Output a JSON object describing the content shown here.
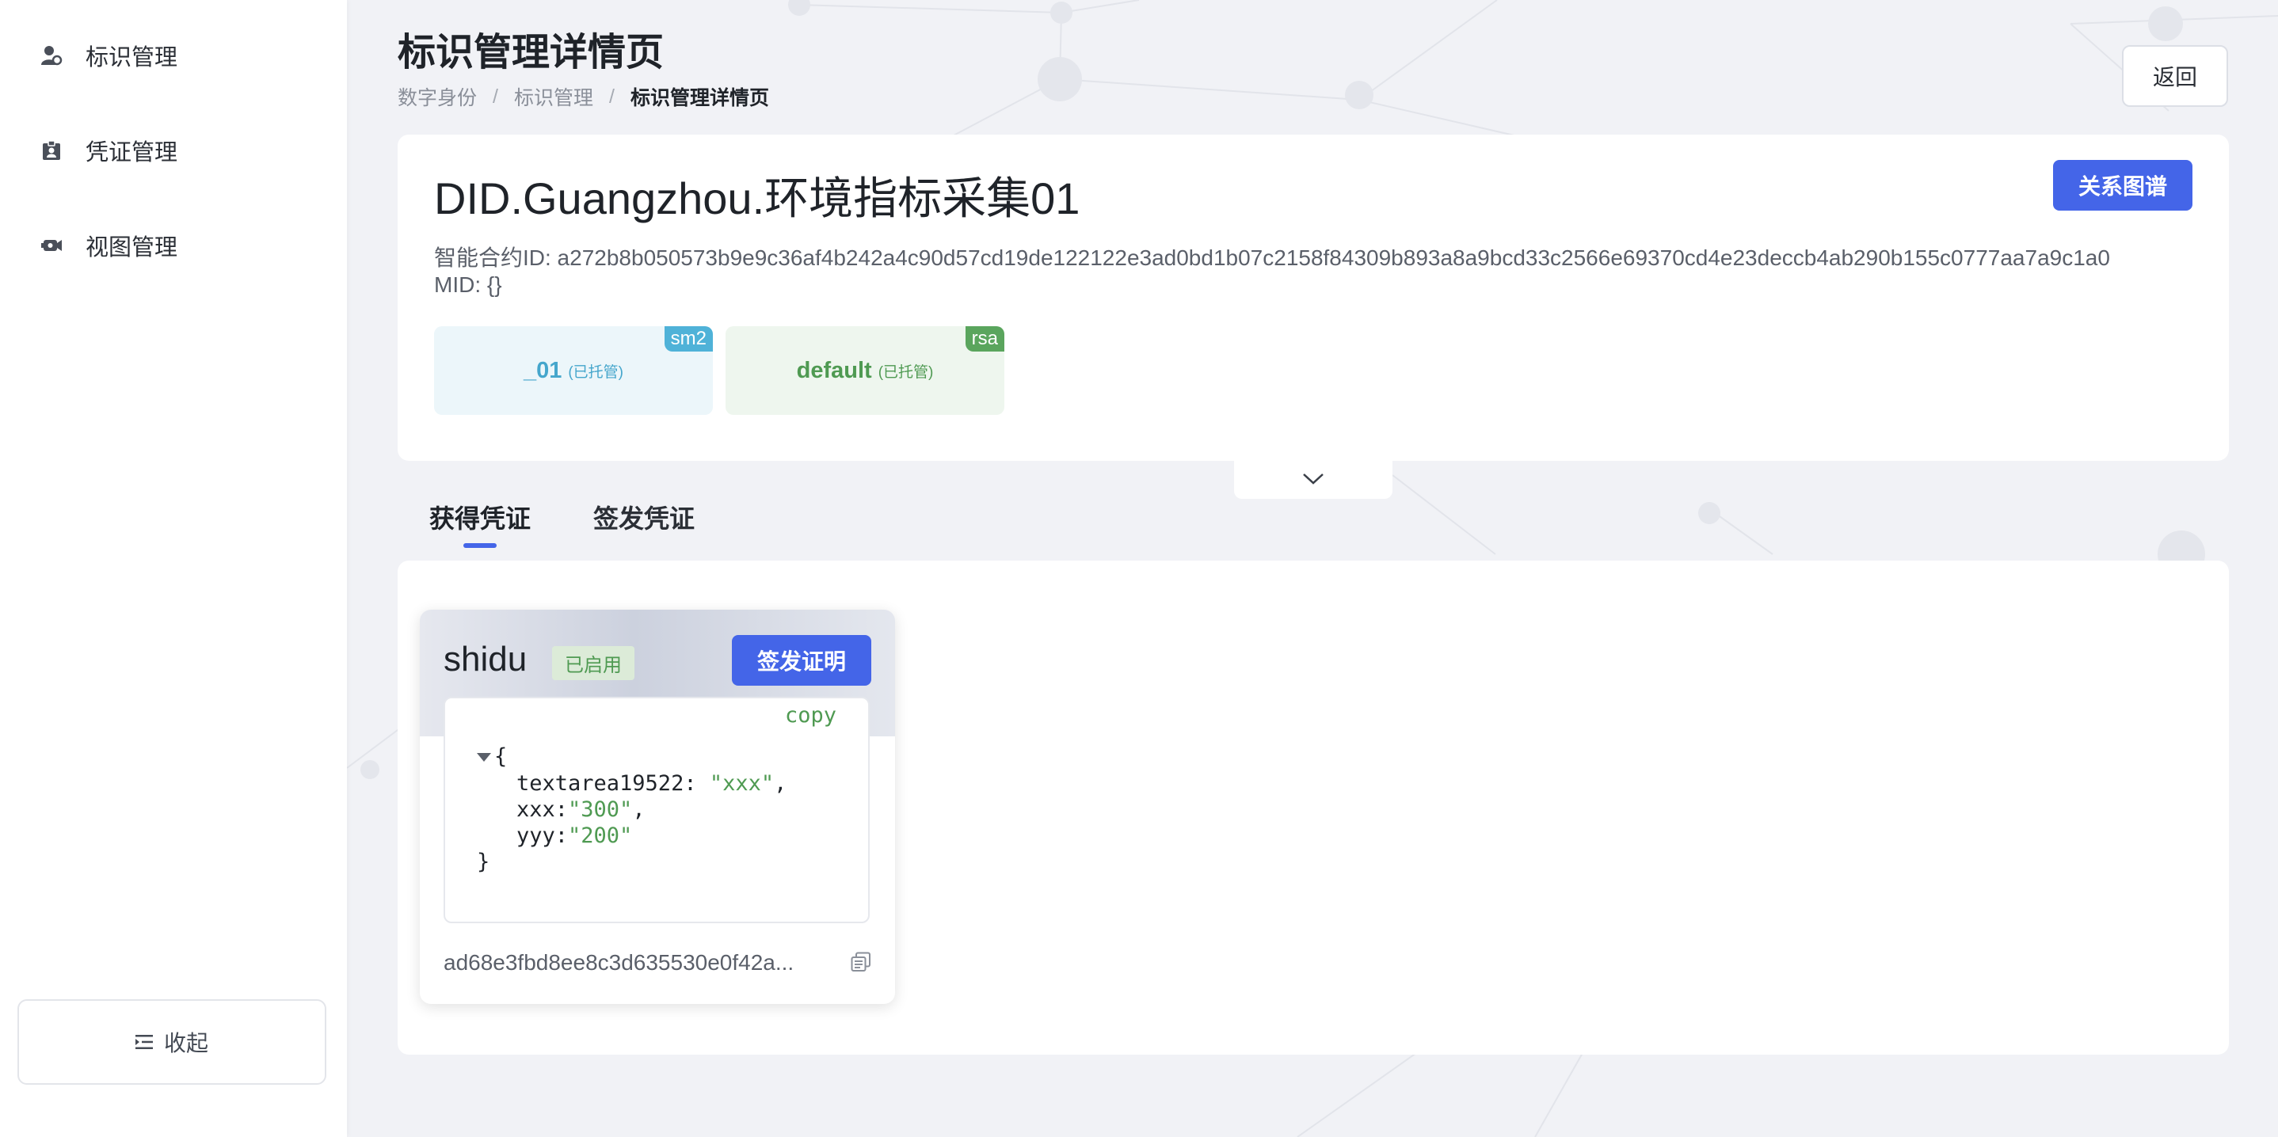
{
  "sidebar": {
    "items": [
      {
        "label": "标识管理",
        "icon": "user-shield-icon"
      },
      {
        "label": "凭证管理",
        "icon": "id-card-icon"
      },
      {
        "label": "视图管理",
        "icon": "camera-icon"
      }
    ],
    "collapse_label": "收起"
  },
  "header": {
    "title": "标识管理详情页",
    "breadcrumb": [
      "数字身份",
      "标识管理",
      "标识管理详情页"
    ],
    "back_label": "返回"
  },
  "identity": {
    "did": "DID.Guangzhou.环境指标采集01",
    "graph_button": "关系图谱",
    "contract_id": "智能合约ID: a272b8b050573b9e9c36af4b242a4c90d57cd19de122122e3ad0bd1b07c2158f84309b893a8a9bcd33c2566e69370cd4e23deccb4ab290b155c0777aa7a9c1a0",
    "mid": "MID: {}",
    "keys": [
      {
        "name": "_01",
        "note": "(已托管)",
        "algo": "sm2",
        "color": "#45a6cc"
      },
      {
        "name": "default",
        "note": "(已托管)",
        "algo": "rsa",
        "color": "#4f9a52"
      }
    ]
  },
  "tabs": [
    {
      "label": "获得凭证",
      "active": true
    },
    {
      "label": "签发凭证",
      "active": false
    }
  ],
  "credential": {
    "name": "shidu",
    "status": "已启用",
    "issue_button": "签发证明",
    "copy_label": "copy",
    "json": {
      "open": "{",
      "close": "}",
      "fields": [
        {
          "key": "textarea19522:",
          "value": "\"xxx\"",
          "trail": ","
        },
        {
          "key": "xxx:",
          "value": "\"300\"",
          "trail": ","
        },
        {
          "key": "yyy:",
          "value": "\"200\"",
          "trail": ""
        }
      ]
    },
    "hash": "ad68e3fbd8ee8c3d635530e0f42a..."
  },
  "colors": {
    "primary": "#4465e8",
    "success": "#4f9a52",
    "info": "#45a6cc"
  }
}
